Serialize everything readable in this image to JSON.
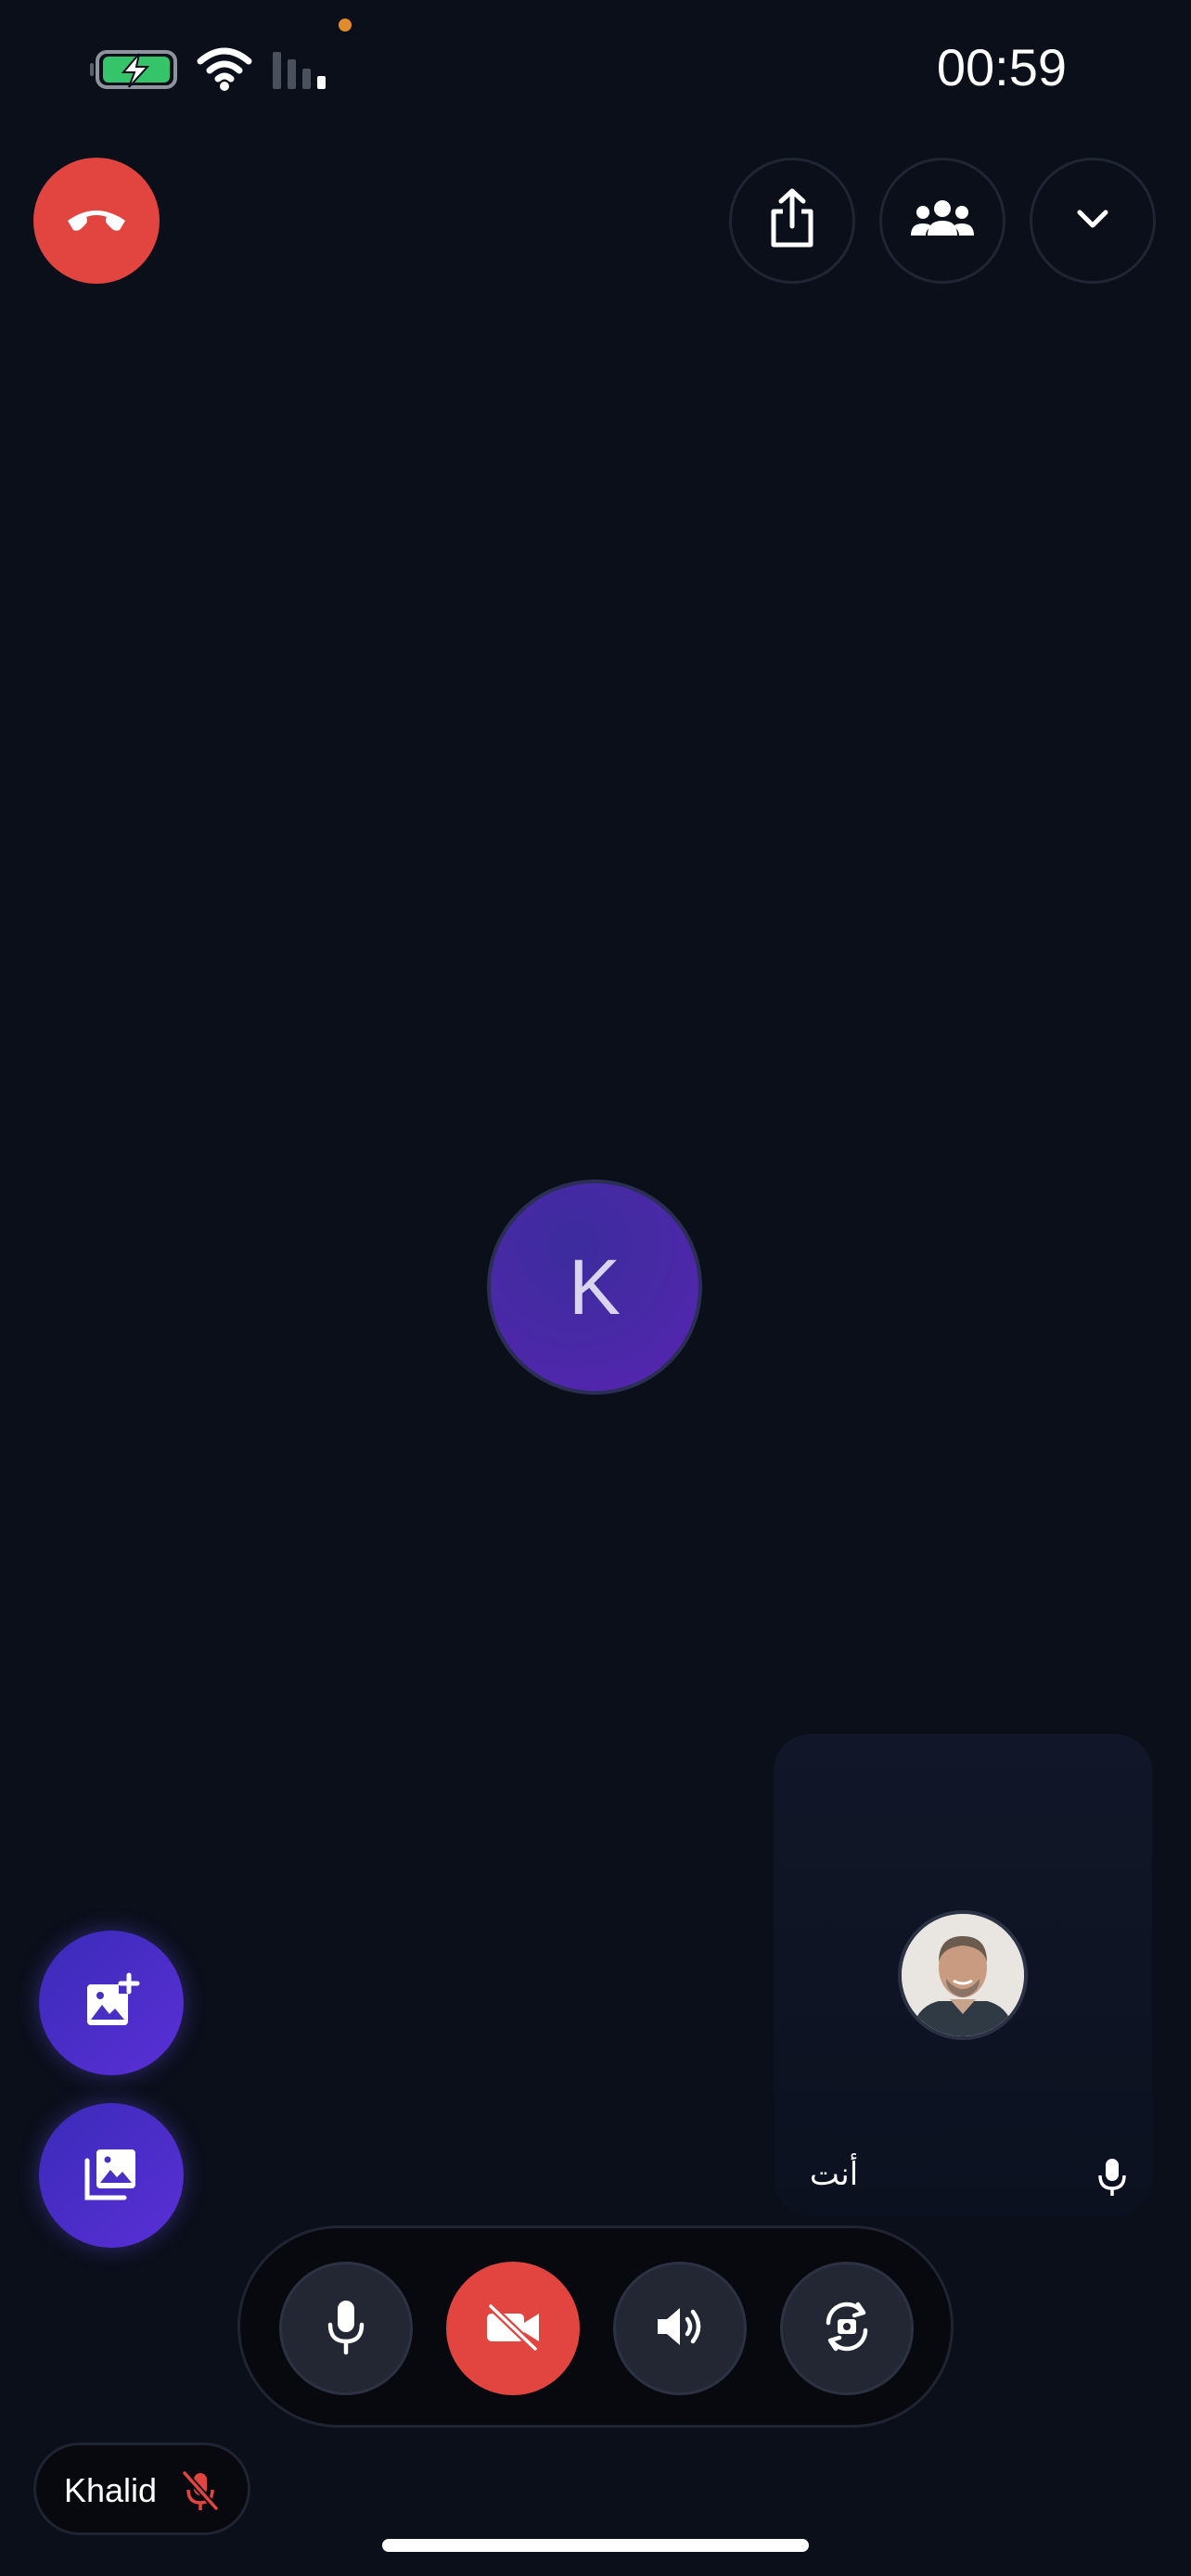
{
  "status_bar": {
    "time": "00:59",
    "battery_icon": "battery-charging-icon",
    "wifi_icon": "wifi-icon",
    "signal_icon": "cellular-signal-icon"
  },
  "top_controls": {
    "end_call_icon": "phone-hangup-icon",
    "share_icon": "share-icon",
    "participants_icon": "participants-icon",
    "collapse_icon": "chevron-down-icon"
  },
  "remote_participant": {
    "initial": "K"
  },
  "self_preview": {
    "label": "أنت",
    "avatar": "self-avatar-photo",
    "mic_icon": "microphone-icon"
  },
  "actions": {
    "add_image_icon": "add-image-icon",
    "gallery_icon": "gallery-icon"
  },
  "controls": {
    "mic_icon": "microphone-icon",
    "camera_icon": "camera-off-icon",
    "speaker_icon": "speaker-icon",
    "flip_camera_icon": "flip-camera-icon"
  },
  "participant_chip": {
    "name": "Khalid",
    "mic_state_icon": "microphone-off-icon"
  },
  "colors": {
    "background": "#0b0f1a",
    "end_call": "#e2443f",
    "camera_off": "#e2443f",
    "accent_purple": "#5a2fd6"
  }
}
